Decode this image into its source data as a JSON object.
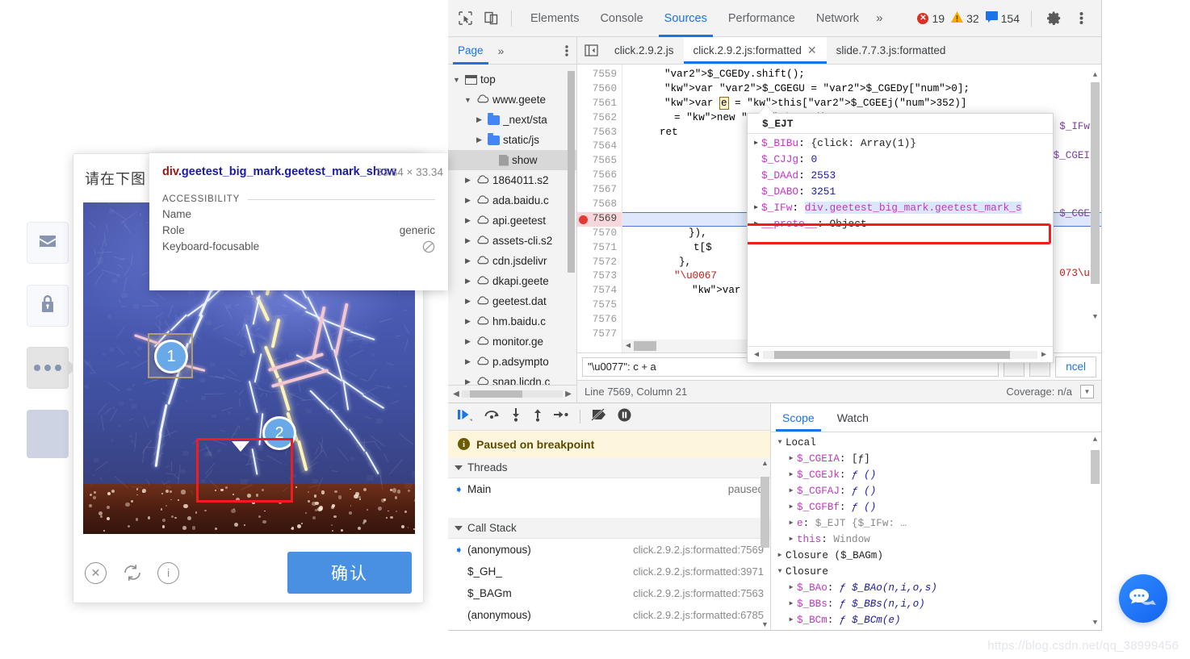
{
  "page": {
    "watermark": "https://blog.csdn.net/qq_38999456",
    "rail": [
      {
        "name": "mail",
        "icon": "envelope-icon"
      },
      {
        "name": "lock",
        "icon": "lock-icon"
      },
      {
        "name": "more",
        "icon": "ellipsis-icon"
      },
      {
        "name": "panel",
        "icon": "panel-block"
      }
    ],
    "chat_fab": "chat-bubble-icon"
  },
  "captcha": {
    "prompt": "请在下图",
    "confirm_label": "确认",
    "marks": [
      "1",
      "2"
    ],
    "footer_icons": [
      "close-circle-icon",
      "refresh-icon",
      "info-circle-icon"
    ]
  },
  "element_tooltip": {
    "tag_part1": "div",
    "tag_part2": ".geetest_big_mark.geetest_mark_show",
    "full_selector": "div.geetest_big_mark.geetest_mark_show",
    "dimensions": "33.34 × 33.34",
    "section_label": "ACCESSIBILITY",
    "rows": [
      {
        "label": "Name",
        "value": ""
      },
      {
        "label": "Role",
        "value": "generic"
      },
      {
        "label": "Keyboard-focusable",
        "value": "⃠"
      }
    ]
  },
  "devtools": {
    "toolbar": {
      "inspect_icon": "inspect-cursor-icon",
      "device_icon": "device-toolbar-icon",
      "tabs": [
        {
          "label": "Elements",
          "active": false
        },
        {
          "label": "Console",
          "active": false
        },
        {
          "label": "Sources",
          "active": true
        },
        {
          "label": "Performance",
          "active": false
        },
        {
          "label": "Network",
          "active": false
        }
      ],
      "overflow": "»",
      "errors": "19",
      "warnings": "32",
      "messages": "154",
      "settings_icon": "gear-icon",
      "kebab_icon": "kebab-menu-icon"
    },
    "navigator": {
      "tab": "Page",
      "overflow": "»",
      "kebab": "⋮",
      "tree": [
        {
          "label": "top",
          "icon": "frame-icon",
          "indent": 0,
          "twisty": "down",
          "selected": false
        },
        {
          "label": "www.geete",
          "icon": "cloud-icon",
          "indent": 1,
          "twisty": "down",
          "selected": false
        },
        {
          "label": "_next/sta",
          "icon": "folder-icon",
          "indent": 2,
          "twisty": "right",
          "selected": false
        },
        {
          "label": "static/js",
          "icon": "folder-icon",
          "indent": 2,
          "twisty": "right",
          "selected": false
        },
        {
          "label": "show",
          "icon": "file-icon",
          "indent": 3,
          "twisty": "none",
          "selected": true
        },
        {
          "label": "1864011.s2",
          "icon": "cloud-icon",
          "indent": 1,
          "twisty": "right",
          "selected": false
        },
        {
          "label": "ada.baidu.c",
          "icon": "cloud-icon",
          "indent": 1,
          "twisty": "right",
          "selected": false
        },
        {
          "label": "api.geetest",
          "icon": "cloud-icon",
          "indent": 1,
          "twisty": "right",
          "selected": false
        },
        {
          "label": "assets-cli.s2",
          "icon": "cloud-icon",
          "indent": 1,
          "twisty": "right",
          "selected": false
        },
        {
          "label": "cdn.jsdelivr",
          "icon": "cloud-icon",
          "indent": 1,
          "twisty": "right",
          "selected": false
        },
        {
          "label": "dkapi.geete",
          "icon": "cloud-icon",
          "indent": 1,
          "twisty": "right",
          "selected": false
        },
        {
          "label": "geetest.dat",
          "icon": "cloud-icon",
          "indent": 1,
          "twisty": "right",
          "selected": false
        },
        {
          "label": "hm.baidu.c",
          "icon": "cloud-icon",
          "indent": 1,
          "twisty": "right",
          "selected": false
        },
        {
          "label": "monitor.ge",
          "icon": "cloud-icon",
          "indent": 1,
          "twisty": "right",
          "selected": false
        },
        {
          "label": "p.adsympto",
          "icon": "cloud-icon",
          "indent": 1,
          "twisty": "right",
          "selected": false
        },
        {
          "label": "snap.licdn.c",
          "icon": "cloud-icon",
          "indent": 1,
          "twisty": "right",
          "selected": false
        }
      ]
    },
    "file_tabs": [
      {
        "label": "click.2.9.2.js",
        "active": false,
        "closable": false
      },
      {
        "label": "click.2.9.2.js:formatted",
        "active": true,
        "closable": true
      },
      {
        "label": "slide.7.7.3.js:formatted",
        "active": false,
        "closable": false
      }
    ],
    "editor": {
      "first_line": 7559,
      "breakpoint_line": 7569,
      "lines": [
        {
          "n": 7559,
          "text": "$_CGEDy.shift();"
        },
        {
          "n": 7560,
          "text": "var $_CGEGU = $_CGEDy[0];"
        },
        {
          "n": 7561,
          "text": "var e = this[$_CGEEj(352)]"
        },
        {
          "n": 7562,
          "text": "= new $_EHT();"
        },
        {
          "n": 7563,
          "text": "ret"
        },
        {
          "n": 7564,
          "text": ""
        },
        {
          "n": 7565,
          "text": ""
        },
        {
          "n": 7566,
          "text": ""
        },
        {
          "n": 7567,
          "text": ""
        },
        {
          "n": 7568,
          "text": ""
        },
        {
          "n": 7569,
          "text": ""
        },
        {
          "n": 7570,
          "text": "}),"
        },
        {
          "n": 7571,
          "text": "t[$"
        },
        {
          "n": 7572,
          "text": "},"
        },
        {
          "n": 7573,
          "text": "\"\\u0067"
        },
        {
          "n": 7574,
          "text": "var"
        },
        {
          "n": 7575,
          "text": ""
        },
        {
          "n": 7576,
          "text": ""
        },
        {
          "n": 7577,
          "text": ""
        }
      ],
      "right_fragments": [
        "$_IFw",
        "$_CGEI",
        "$_CGE",
        "073\\u"
      ],
      "token_highlight": "e"
    },
    "object_popup": {
      "title": "$_EJT",
      "rows": [
        {
          "twisty": "right",
          "key": "$_BIBu",
          "value": "{click: Array(1)}",
          "kind": "obj"
        },
        {
          "twisty": "none",
          "key": "$_CJJg",
          "value": "0",
          "kind": "num"
        },
        {
          "twisty": "none",
          "key": "$_DAAd",
          "value": "2553",
          "kind": "num"
        },
        {
          "twisty": "none",
          "key": "$_DABO",
          "value": "3251",
          "kind": "num"
        },
        {
          "twisty": "right",
          "key": "$_IFw",
          "value": "div.geetest_big_mark.geetest_mark_s",
          "kind": "node",
          "highlighted": true
        },
        {
          "twisty": "right",
          "key": "__proto__",
          "value": "Object",
          "kind": "obj"
        }
      ]
    },
    "console_input": {
      "value": "\"\\u0077\": c + a",
      "cancel_label": "ncel"
    },
    "status": {
      "position": "Line 7569, Column 21",
      "coverage": "Coverage: n/a"
    },
    "debugger": {
      "toolbar_icons": [
        "resume-script-icon",
        "step-over-icon",
        "step-into-icon",
        "step-out-icon",
        "step-icon",
        "deactivate-breakpoints-icon",
        "pause-on-exceptions-icon"
      ],
      "paused_message": "Paused on breakpoint",
      "threads_label": "Threads",
      "threads": [
        {
          "name": "Main",
          "state": "paused",
          "current": true
        }
      ],
      "call_stack_label": "Call Stack",
      "call_stack": [
        {
          "fn": "(anonymous)",
          "loc": "click.2.9.2.js:formatted:7569",
          "current": true
        },
        {
          "fn": "$_GH_",
          "loc": "click.2.9.2.js:formatted:3971",
          "current": false
        },
        {
          "fn": "$_BAGm",
          "loc": "click.2.9.2.js:formatted:7563",
          "current": false
        },
        {
          "fn": "(anonymous)",
          "loc": "click.2.9.2.js:formatted:6785",
          "current": false
        }
      ],
      "scope_tabs": [
        {
          "label": "Scope",
          "active": true
        },
        {
          "label": "Watch",
          "active": false
        }
      ],
      "scope": [
        {
          "indent": 0,
          "twisty": "down",
          "text": "Local",
          "type": "group"
        },
        {
          "indent": 1,
          "twisty": "right",
          "key": "$_CGEIA",
          "value": "[ƒ]",
          "type": "prop"
        },
        {
          "indent": 1,
          "twisty": "right",
          "key": "$_CGEJk",
          "value": "ƒ ()",
          "type": "fn"
        },
        {
          "indent": 1,
          "twisty": "right",
          "key": "$_CGFAJ",
          "value": "ƒ ()",
          "type": "fn"
        },
        {
          "indent": 1,
          "twisty": "right",
          "key": "$_CGFBf",
          "value": "ƒ ()",
          "type": "fn"
        },
        {
          "indent": 1,
          "twisty": "right",
          "key": "e",
          "value": "$_EJT {$_IFw: …",
          "type": "obj"
        },
        {
          "indent": 1,
          "twisty": "right",
          "key": "this",
          "value": "Window",
          "type": "obj"
        },
        {
          "indent": 0,
          "twisty": "right",
          "text": "Closure ($_BAGm)",
          "type": "group"
        },
        {
          "indent": 0,
          "twisty": "down",
          "text": "Closure",
          "type": "group"
        },
        {
          "indent": 1,
          "twisty": "right",
          "key": "$_BAo",
          "value": "ƒ $_BAo(n,i,o,s)",
          "type": "fn"
        },
        {
          "indent": 1,
          "twisty": "right",
          "key": "$_BBs",
          "value": "ƒ $_BBs(n,i,o)",
          "type": "fn"
        },
        {
          "indent": 1,
          "twisty": "right",
          "key": "$_BCm",
          "value": "ƒ $_BCm(e)",
          "type": "fn"
        }
      ]
    }
  },
  "colors": {
    "accent": "#1a73e8",
    "error": "#d93025",
    "warning": "#f9ab00",
    "highlight_ring": "#f11c1c",
    "confirm_button": "#4a90e2"
  }
}
